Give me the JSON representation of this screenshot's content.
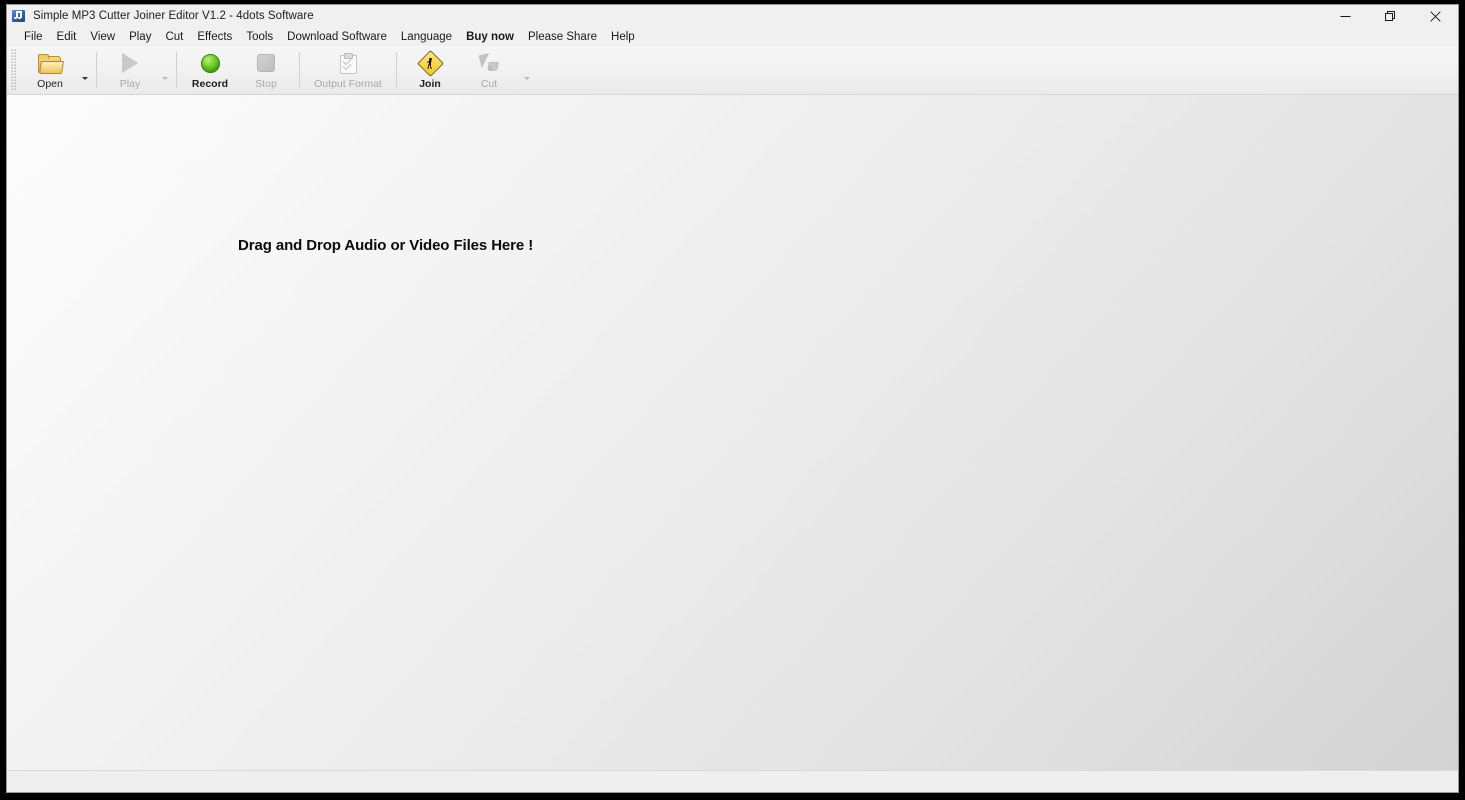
{
  "window": {
    "title": "Simple MP3 Cutter Joiner Editor V1.2 - 4dots Software",
    "app_icon": "music-note-icon",
    "controls": {
      "minimize": "minimize-icon",
      "maximize": "restore-icon",
      "close": "close-icon"
    }
  },
  "menu": {
    "items": [
      {
        "label": "File",
        "bold": false
      },
      {
        "label": "Edit",
        "bold": false
      },
      {
        "label": "View",
        "bold": false
      },
      {
        "label": "Play",
        "bold": false
      },
      {
        "label": "Cut",
        "bold": false
      },
      {
        "label": "Effects",
        "bold": false
      },
      {
        "label": "Tools",
        "bold": false
      },
      {
        "label": "Download Software",
        "bold": false
      },
      {
        "label": "Language",
        "bold": false
      },
      {
        "label": "Buy now",
        "bold": true
      },
      {
        "label": "Please Share",
        "bold": false
      },
      {
        "label": "Help",
        "bold": false
      }
    ]
  },
  "toolbar": {
    "buttons": [
      {
        "label": "Open",
        "icon": "open-folder-icon",
        "enabled": true,
        "bold": false,
        "has_dropdown": true,
        "dropdown_enabled": true
      },
      {
        "label": "Play",
        "icon": "play-icon",
        "enabled": false,
        "bold": false,
        "has_dropdown": true,
        "dropdown_enabled": false
      },
      {
        "label": "Record",
        "icon": "record-icon",
        "enabled": true,
        "bold": true,
        "has_dropdown": false,
        "dropdown_enabled": false
      },
      {
        "label": "Stop",
        "icon": "stop-icon",
        "enabled": false,
        "bold": false,
        "has_dropdown": false,
        "dropdown_enabled": false
      },
      {
        "label": "Output Format",
        "icon": "output-format-icon",
        "enabled": false,
        "bold": false,
        "has_dropdown": false,
        "dropdown_enabled": false
      },
      {
        "label": "Join",
        "icon": "join-icon",
        "enabled": true,
        "bold": true,
        "has_dropdown": false,
        "dropdown_enabled": false
      },
      {
        "label": "Cut",
        "icon": "cut-icon",
        "enabled": false,
        "bold": false,
        "has_dropdown": true,
        "dropdown_enabled": false
      }
    ]
  },
  "content": {
    "drop_hint": "Drag and Drop Audio or Video Files Here !"
  },
  "status": {
    "text": ""
  },
  "colors": {
    "accent_yellow": "#f2c81e",
    "record_green": "#6dcc27",
    "window_chrome": "#f0f0f0",
    "content_light": "#fcfcfc",
    "content_dark": "#d3d3d3",
    "close_hover": "#e81123"
  }
}
